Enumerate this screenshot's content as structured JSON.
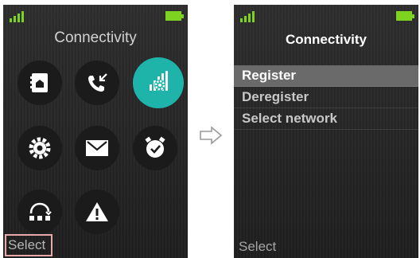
{
  "left_screen": {
    "title": "Connectivity",
    "softkey_left": "Select",
    "icons": [
      {
        "name": "contacts-icon",
        "selected": false
      },
      {
        "name": "call-log-icon",
        "selected": false
      },
      {
        "name": "connectivity-icon",
        "selected": true
      },
      {
        "name": "settings-icon",
        "selected": false
      },
      {
        "name": "messages-icon",
        "selected": false
      },
      {
        "name": "alarm-clock-icon",
        "selected": false
      },
      {
        "name": "headset-icon",
        "selected": false
      },
      {
        "name": "warning-icon",
        "selected": false
      }
    ]
  },
  "right_screen": {
    "title": "Connectivity",
    "softkey_left": "Select",
    "menu": [
      {
        "label": "Register",
        "selected": true
      },
      {
        "label": "Deregister",
        "selected": false
      },
      {
        "label": "Select network",
        "selected": false
      }
    ]
  },
  "colors": {
    "accent": "#1fb4aa",
    "status_green": "#7ed321",
    "screen_bg": "#2b2b2b",
    "highlight": "#6a6a6a"
  }
}
